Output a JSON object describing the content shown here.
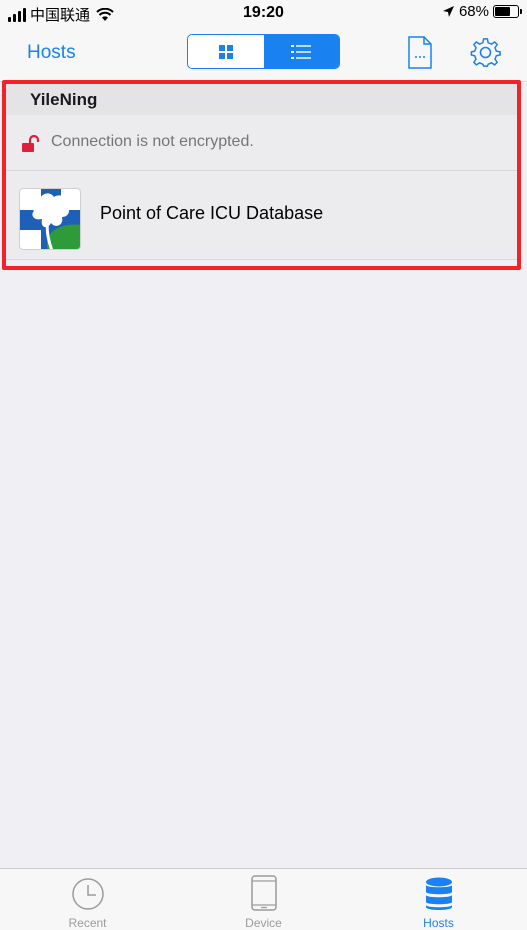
{
  "status_bar": {
    "carrier": "中国联通",
    "time": "19:20",
    "battery": "68%",
    "battery_level": 0.68
  },
  "nav": {
    "title": "Hosts",
    "view_modes": [
      "grid",
      "list"
    ],
    "active_view": "list"
  },
  "host": {
    "name": "YileNing",
    "connection_status": "Connection is not encrypted.",
    "databases": [
      {
        "name": "Point of Care ICU Database"
      }
    ]
  },
  "tabs": [
    {
      "label": "Recent",
      "icon": "clock-icon"
    },
    {
      "label": "Device",
      "icon": "device-icon"
    },
    {
      "label": "Hosts",
      "icon": "database-icon",
      "active": true
    }
  ],
  "colors": {
    "accent": "#1a82f0",
    "highlight": "#f2212a",
    "lock": "#e0203a"
  }
}
